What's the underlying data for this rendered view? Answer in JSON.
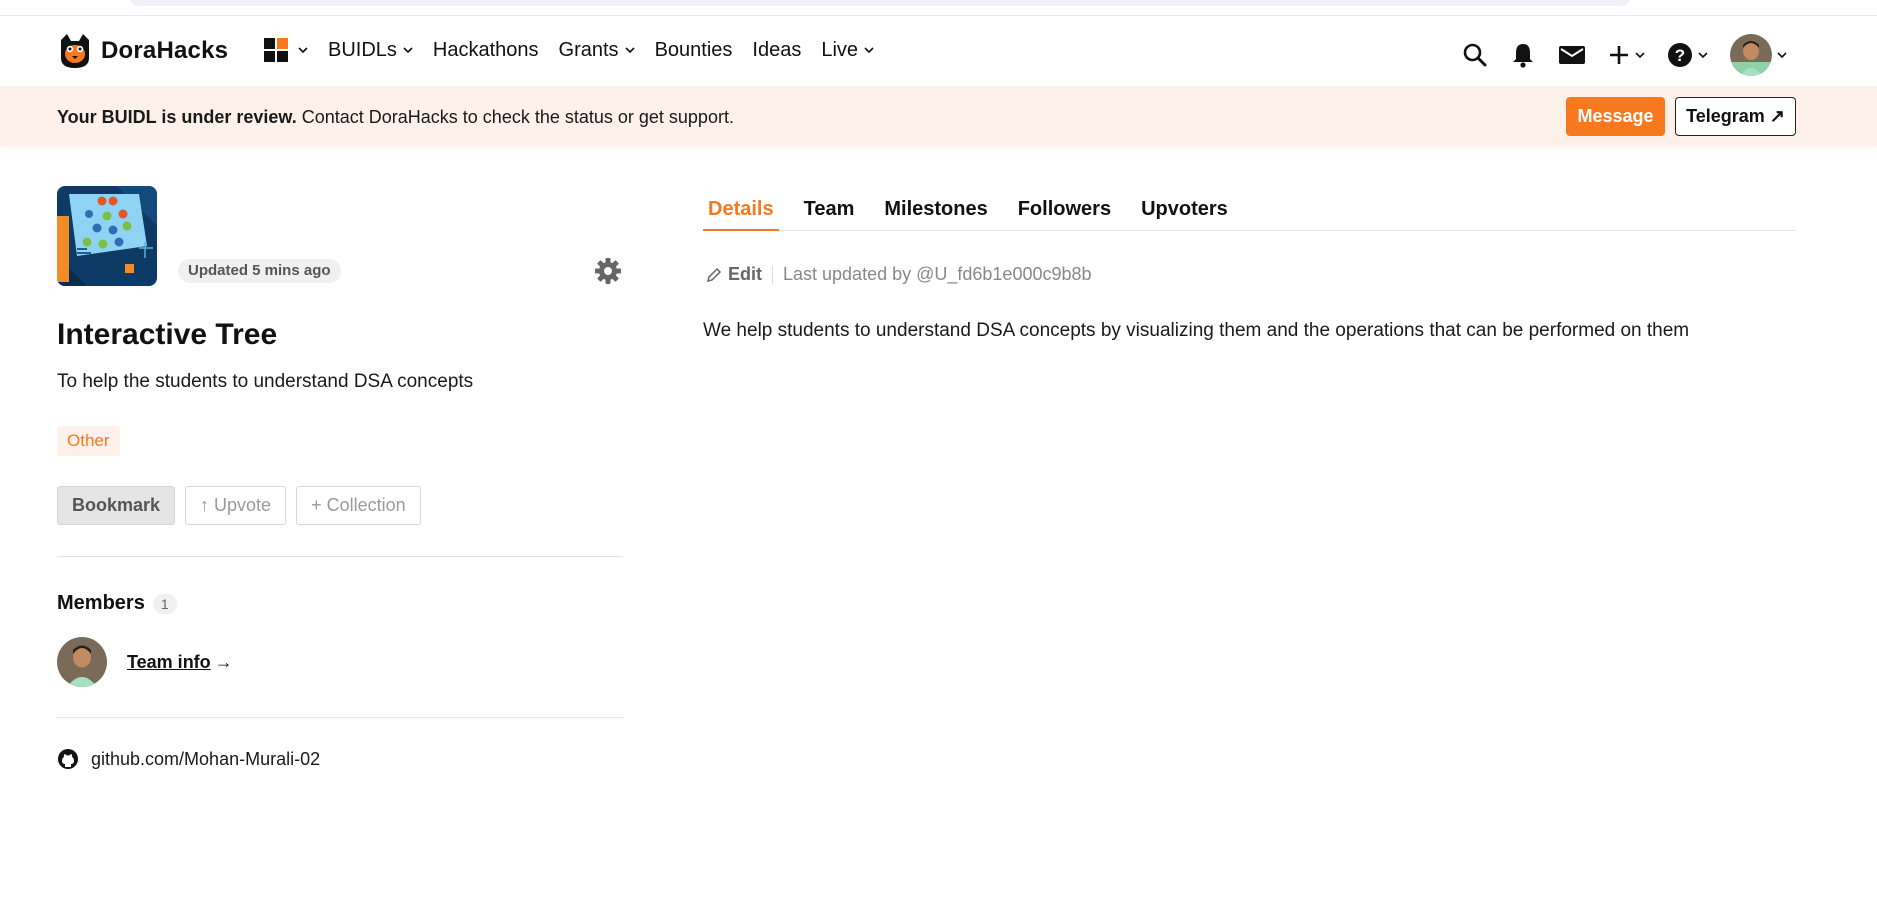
{
  "brand": {
    "name": "DoraHacks",
    "accent": "#f7781f"
  },
  "nav": {
    "items": [
      {
        "label": "BUIDLs",
        "has_dropdown": true
      },
      {
        "label": "Hackathons",
        "has_dropdown": false
      },
      {
        "label": "Grants",
        "has_dropdown": true
      },
      {
        "label": "Bounties",
        "has_dropdown": false
      },
      {
        "label": "Ideas",
        "has_dropdown": false
      },
      {
        "label": "Live",
        "has_dropdown": true
      }
    ],
    "right_icons": [
      "search-icon",
      "bell-icon",
      "mail-icon",
      "plus-icon",
      "help-icon",
      "avatar"
    ]
  },
  "banner": {
    "bold_text": "Your BUIDL is under review.",
    "text": " Contact DoraHacks to check the status or get support.",
    "message_label": "Message",
    "telegram_label": "Telegram ↗"
  },
  "project": {
    "updated": "Updated 5 mins ago",
    "title": "Interactive Tree",
    "subtitle": "To help the students to understand DSA concepts",
    "tag": "Other",
    "bookmark_label": "Bookmark",
    "upvote_label": "↑ Upvote",
    "collection_label": "+ Collection"
  },
  "members": {
    "title": "Members",
    "count": "1",
    "team_info_label": "Team info",
    "arrow": "→"
  },
  "links": {
    "github": "github.com/Mohan-Murali-02"
  },
  "tabs": [
    {
      "label": "Details",
      "active": true
    },
    {
      "label": "Team",
      "active": false
    },
    {
      "label": "Milestones",
      "active": false
    },
    {
      "label": "Followers",
      "active": false
    },
    {
      "label": "Upvoters",
      "active": false
    }
  ],
  "details": {
    "edit_label": "Edit",
    "last_updated": "Last updated by @U_fd6b1e000c9b8b",
    "body": "We help students to understand DSA concepts by visualizing them and the operations that can be performed on them"
  }
}
